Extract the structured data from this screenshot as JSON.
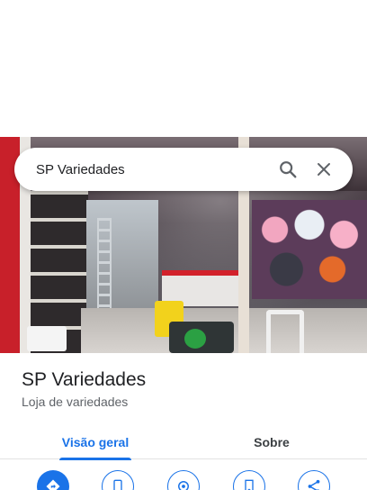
{
  "search": {
    "query": "SP Variedades"
  },
  "place": {
    "name": "SP Variedades",
    "category": "Loja de variedades"
  },
  "tabs": [
    {
      "label": "Visão geral",
      "selected": true
    },
    {
      "label": "Sobre",
      "selected": false
    }
  ],
  "actions": [
    {
      "icon": "directions-icon",
      "style": "primary"
    },
    {
      "icon": "phone-icon",
      "style": "outline"
    },
    {
      "icon": "location-icon",
      "style": "outline"
    },
    {
      "icon": "save-icon",
      "style": "outline"
    },
    {
      "icon": "share-icon",
      "style": "outline"
    }
  ],
  "colors": {
    "accent": "#1a73e8",
    "text_primary": "#202124",
    "text_secondary": "#5f6368"
  }
}
